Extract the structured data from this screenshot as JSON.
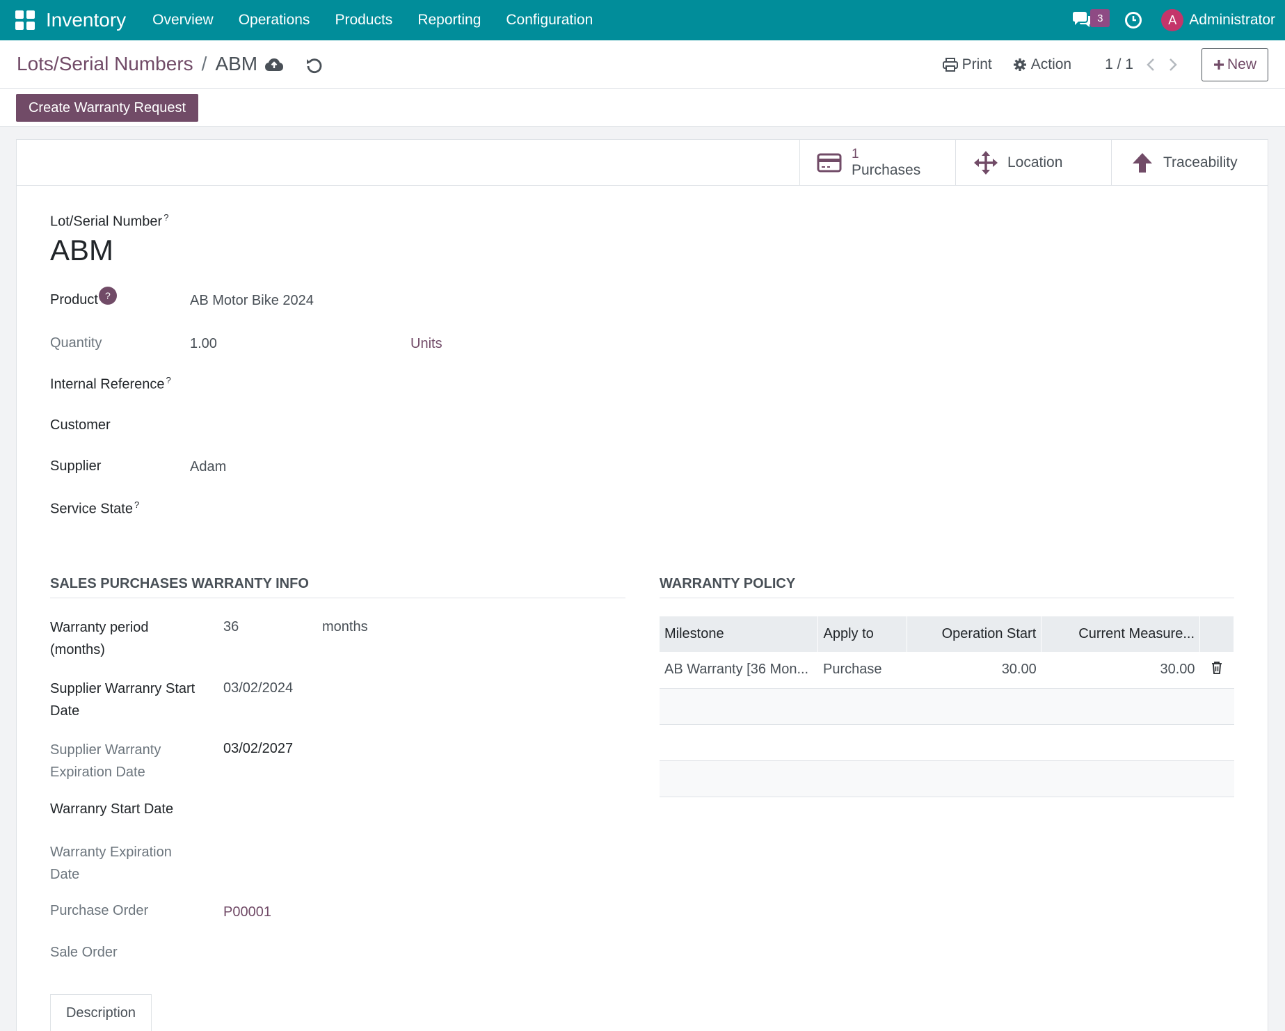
{
  "navbar": {
    "app_name": "Inventory",
    "menu": [
      "Overview",
      "Operations",
      "Products",
      "Reporting",
      "Configuration"
    ],
    "chat_count": "3",
    "user_initial": "A",
    "user_name": "Administrator",
    "icons": [
      "apps-grid-icon",
      "chat-icon",
      "clock-icon"
    ]
  },
  "control_panel": {
    "breadcrumb_parent": "Lots/Serial Numbers",
    "breadcrumb_separator": "/",
    "breadcrumb_current": "ABM",
    "print_label": "Print",
    "action_label": "Action",
    "pager": "1 / 1",
    "new_label": "New",
    "icons": [
      "cloud-save-icon",
      "discard-icon",
      "printer-icon",
      "gear-icon",
      "chevron-left-icon",
      "chevron-right-icon",
      "plus-icon"
    ]
  },
  "statusbar": {
    "warranty_button": "Create Warranty Request"
  },
  "smart_buttons": {
    "purchases": {
      "count": "1",
      "label": "Purchases"
    },
    "location": {
      "label": "Location"
    },
    "traceability": {
      "label": "Traceability"
    }
  },
  "form": {
    "lot_label": "Lot/Serial Number",
    "lot_value": "ABM",
    "help_mark": "?",
    "product_label": "Product",
    "product_value": "AB Motor Bike 2024",
    "quantity_label": "Quantity",
    "quantity_value": "1.00",
    "quantity_uom": "Units",
    "internal_ref_label": "Internal Reference",
    "customer_label": "Customer",
    "supplier_label": "Supplier",
    "supplier_value": "Adam",
    "service_state_label": "Service State"
  },
  "warranty_info": {
    "title": "SALES PURCHASES WARRANTY INFO",
    "period_label_1": "Warranty period",
    "period_label_2": "(months)",
    "period_value": "36",
    "period_unit": "months",
    "sup_start_label_1": "Supplier Warranry Start",
    "sup_start_label_2": "Date",
    "sup_start_value": "03/02/2024",
    "sup_exp_label_1": "Supplier Warranty",
    "sup_exp_label_2": "Expiration Date",
    "sup_exp_value": "03/02/2027",
    "start_label": "Warranry Start Date",
    "exp_label_1": "Warranty Expiration",
    "exp_label_2": "Date",
    "po_label": "Purchase Order",
    "po_value": "P00001",
    "so_label": "Sale Order"
  },
  "warranty_policy": {
    "title": "WARRANTY POLICY",
    "columns": [
      "Milestone",
      "Apply to",
      "Operation Start",
      "Current Measure..."
    ],
    "rows": [
      {
        "milestone": "AB Warranty [36 Mon...",
        "apply_to": "Purchase",
        "operation_start": "30.00",
        "current_measure": "30.00"
      }
    ]
  },
  "tabs": {
    "description": "Description"
  },
  "colors": {
    "navbar": "#018d9a",
    "brand": "#714b67",
    "badge": "#8e4a84",
    "avatar": "#c4356a"
  }
}
